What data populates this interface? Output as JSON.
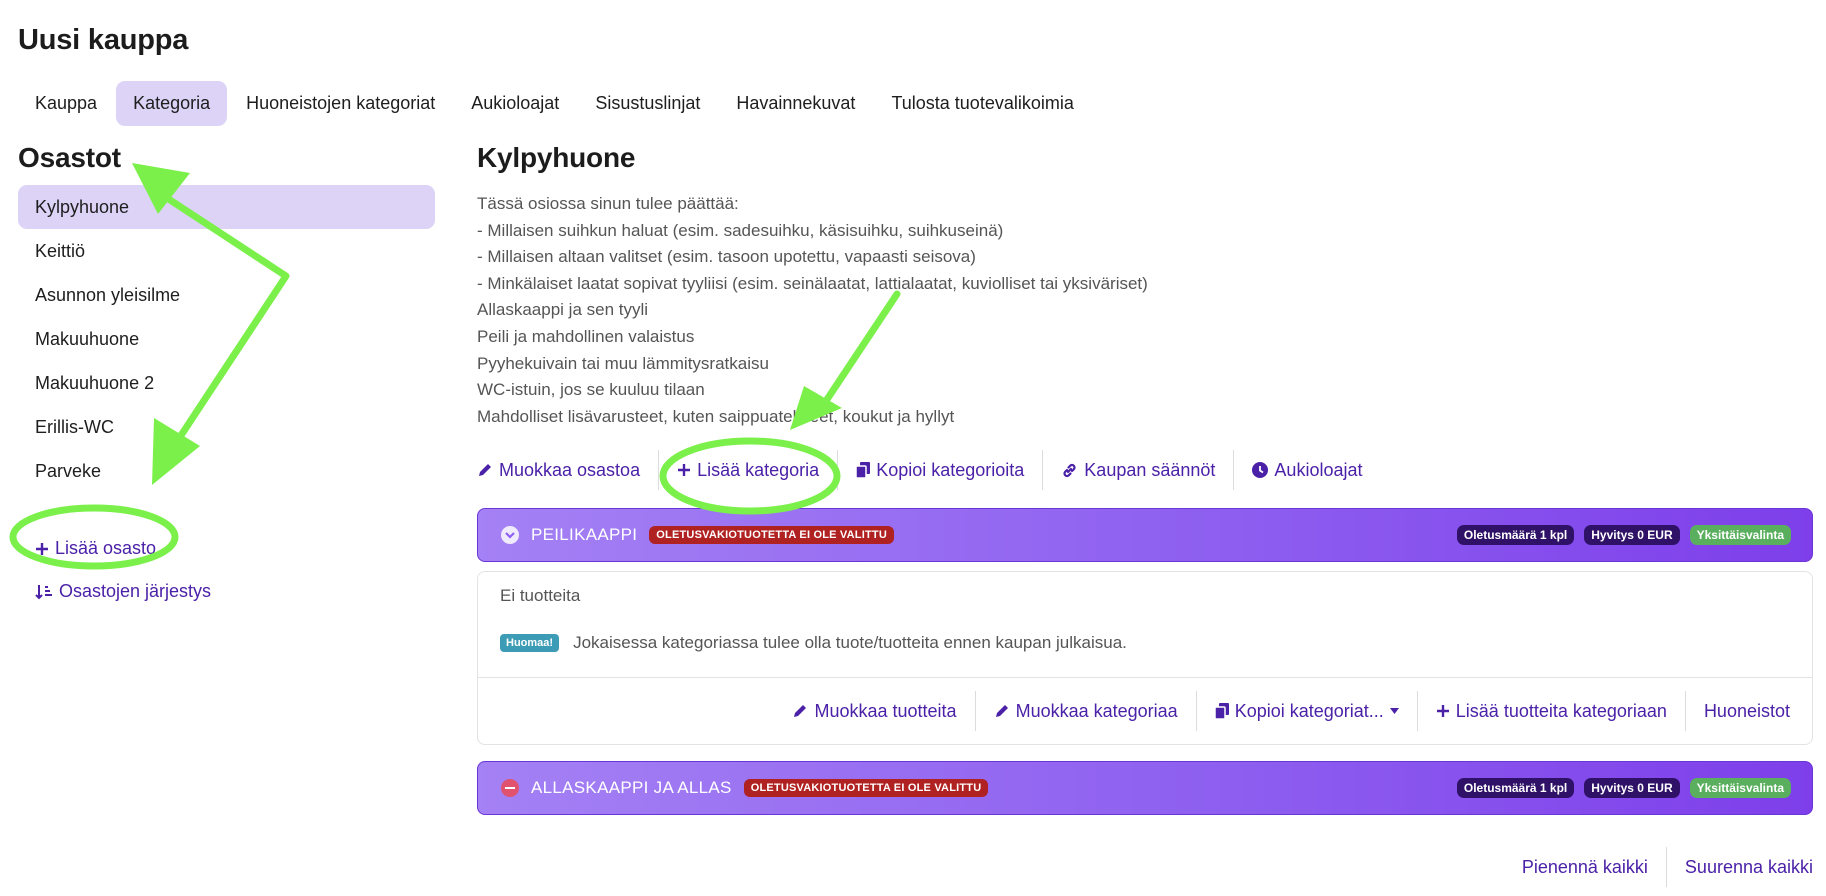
{
  "page": {
    "title": "Uusi kauppa"
  },
  "tabs": [
    {
      "label": "Kauppa",
      "active": false
    },
    {
      "label": "Kategoria",
      "active": true
    },
    {
      "label": "Huoneistojen kategoriat",
      "active": false
    },
    {
      "label": "Aukioloajat",
      "active": false
    },
    {
      "label": "Sisustuslinjat",
      "active": false
    },
    {
      "label": "Havainnekuvat",
      "active": false
    },
    {
      "label": "Tulosta tuotevalikoimia",
      "active": false
    }
  ],
  "sidebar": {
    "title": "Osastot",
    "items": [
      {
        "label": "Kylpyhuone",
        "active": true
      },
      {
        "label": "Keittiö",
        "active": false
      },
      {
        "label": "Asunnon yleisilme",
        "active": false
      },
      {
        "label": "Makuuhuone",
        "active": false
      },
      {
        "label": "Makuuhuone 2",
        "active": false
      },
      {
        "label": "Erillis-WC",
        "active": false
      },
      {
        "label": "Parveke",
        "active": false
      }
    ],
    "add_label": "Lisää osasto",
    "order_label": "Osastojen järjestys"
  },
  "main": {
    "title": "Kylpyhuone",
    "description": [
      "Tässä osiossa sinun tulee päättää:",
      "- Millaisen suihkun haluat (esim. sadesuihku, käsisuihku, suihkuseinä)",
      "- Millaisen altaan valitset (esim. tasoon upotettu, vapaasti seisova)",
      "- Minkälaiset laatat sopivat tyyliisi (esim. seinälaatat, lattialaatat, kuviolliset tai yksiväriset)",
      "Allaskaappi ja sen tyyli",
      "Peili ja mahdollinen valaistus",
      "Pyyhekuivain tai muu lämmitysratkaisu",
      "WC-istuin, jos se kuuluu tilaan",
      "Mahdolliset lisävarusteet, kuten saippuatelineet, koukut ja hyllyt"
    ],
    "actions": {
      "edit_department": "Muokkaa osastoa",
      "add_category": "Lisää kategoria",
      "copy_categories": "Kopioi kategorioita",
      "store_rules": "Kaupan säännöt",
      "opening_hours": "Aukioloajat"
    }
  },
  "categories": [
    {
      "name": "PEILIKAAPPI",
      "warning": "OLETUSVAKIOTUOTETTA EI OLE VALITTU",
      "default_qty": "Oletusmäärä 1 kpl",
      "refund": "Hyvitys 0 EUR",
      "selection": "Yksittäisvalinta",
      "no_products": "Ei tuotteita",
      "note_badge": "Huomaa!",
      "note_text": "Jokaisessa kategoriassa tulee olla tuote/tuotteita ennen kaupan julkaisua.",
      "actions": {
        "edit_products": "Muokkaa tuotteita",
        "edit_category": "Muokkaa kategoriaa",
        "copy_categories": "Kopioi kategoriat...",
        "add_products": "Lisää tuotteita kategoriaan",
        "apartments": "Huoneistot"
      }
    },
    {
      "name": "ALLASKAAPPI JA ALLAS",
      "warning": "OLETUSVAKIOTUOTETTA EI OLE VALITTU",
      "default_qty": "Oletusmäärä 1 kpl",
      "refund": "Hyvitys 0 EUR",
      "selection": "Yksittäisvalinta"
    }
  ],
  "footer": {
    "collapse_all": "Pienennä kaikki",
    "expand_all": "Suurenna kaikki"
  },
  "colors": {
    "accent": "#4b21a8",
    "active_bg": "#dcd3f7",
    "header_gradient_start": "#a481f4",
    "header_gradient_end": "#7e3fea",
    "annotation_green": "#7cf04a",
    "warning_red": "#b02121",
    "selection_green": "#5aaf5e"
  }
}
